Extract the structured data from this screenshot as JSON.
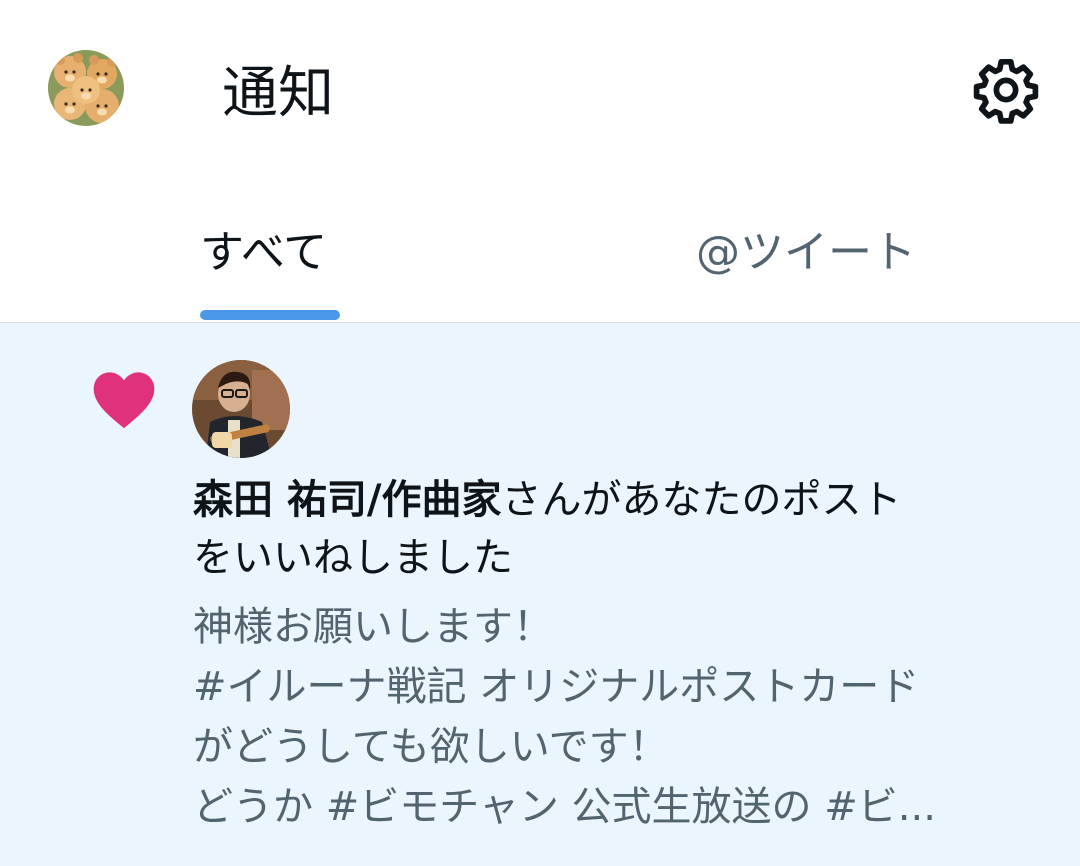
{
  "header": {
    "title": "通知",
    "avatar_icon": "profile-avatar",
    "settings_icon": "gear-icon"
  },
  "tabs": [
    {
      "label": "すべて",
      "selected": true
    },
    {
      "label": "@ツイート",
      "selected": false
    }
  ],
  "colors": {
    "accent": "#4a99e9",
    "heart": "#e0317d",
    "unread_background": "#eaf5fd",
    "secondary_text": "#536471",
    "primary_text": "#0f1419"
  },
  "notification": {
    "type_icon": "heart-icon",
    "user_name": "森田 祐司/作曲家",
    "action_text_line1": "さんがあなたのポスト",
    "action_text_line2": "をいいねしました",
    "tweet_lines": [
      "神様お願いします！",
      "#イルーナ戦記 オリジナルポストカード",
      "がどうしても欲しいです！",
      "どうか #ビモチャン 公式生放送の #ビ..."
    ]
  }
}
